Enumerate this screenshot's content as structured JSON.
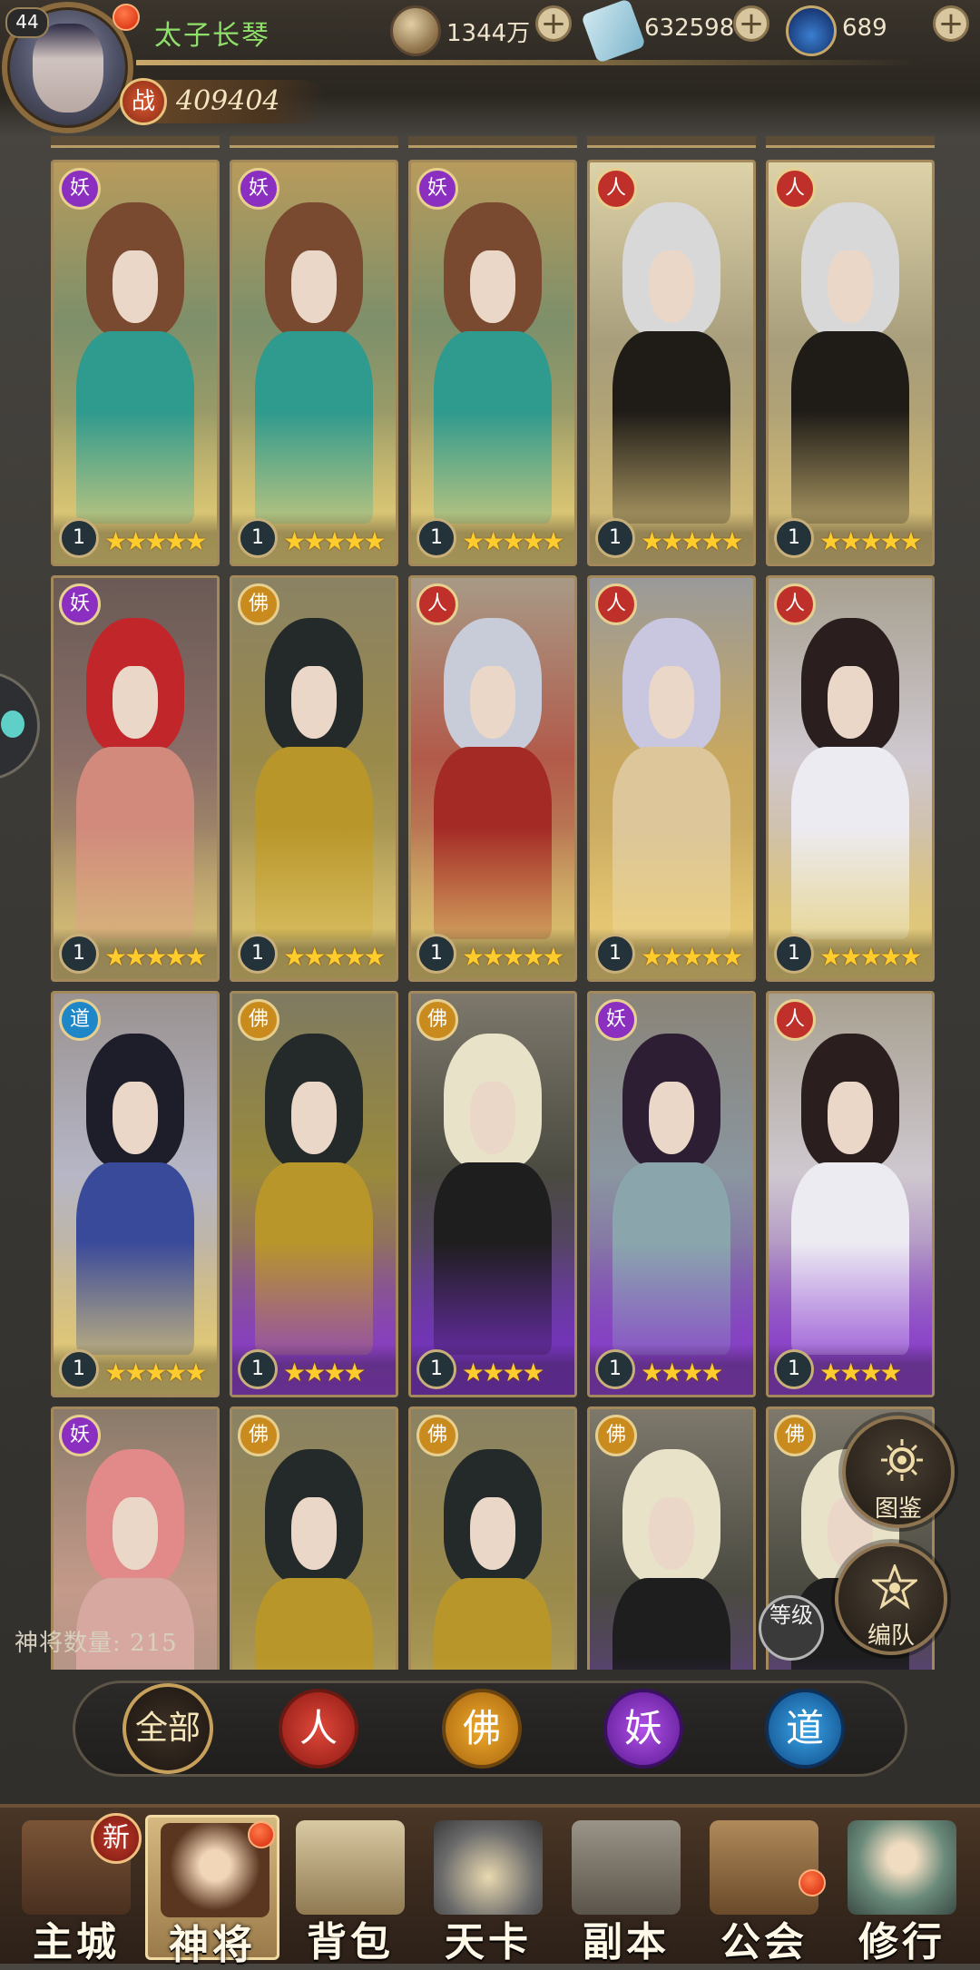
{
  "player": {
    "level": "44",
    "name": "太子长琴",
    "power_label": "战",
    "power": "409404"
  },
  "resources": [
    {
      "icon": "copper-coin-icon",
      "value": "1344万"
    },
    {
      "icon": "scroll-ticket-icon",
      "value": "632598"
    },
    {
      "icon": "spirit-flask-icon",
      "value": "689"
    }
  ],
  "colors": {
    "gold_star": "#ffcc2e",
    "faction_ren": "#c0302a",
    "faction_fo": "#c98a1e",
    "faction_yao": "#8a2fc0",
    "faction_dao": "#1f86c8"
  },
  "heroes": [
    {
      "faction": "妖",
      "level": "1",
      "stars": "★★★★★",
      "tone": "teal"
    },
    {
      "faction": "妖",
      "level": "1",
      "stars": "★★★★★",
      "tone": "teal"
    },
    {
      "faction": "妖",
      "level": "1",
      "stars": "★★★★★",
      "tone": "teal"
    },
    {
      "faction": "人",
      "level": "1",
      "stars": "★★★★★",
      "tone": "elder"
    },
    {
      "faction": "人",
      "level": "1",
      "stars": "★★★★★",
      "tone": "elder"
    },
    {
      "faction": "妖",
      "level": "1",
      "stars": "★★★★★",
      "tone": "fox"
    },
    {
      "faction": "佛",
      "level": "1",
      "stars": "★★★★★",
      "tone": "monk"
    },
    {
      "faction": "人",
      "level": "1",
      "stars": "★★★★★",
      "tone": "warrior"
    },
    {
      "faction": "人",
      "level": "1",
      "stars": "★★★★★",
      "tone": "feather"
    },
    {
      "faction": "人",
      "level": "1",
      "stars": "★★★★★",
      "tone": "bunny"
    },
    {
      "faction": "道",
      "level": "1",
      "stars": "★★★★★",
      "tone": "blue"
    },
    {
      "faction": "佛",
      "level": "1",
      "stars": "★★★★",
      "tone": "monk-purple"
    },
    {
      "faction": "佛",
      "level": "1",
      "stars": "★★★★",
      "tone": "white-hair"
    },
    {
      "faction": "妖",
      "level": "1",
      "stars": "★★★★",
      "tone": "fan"
    },
    {
      "faction": "人",
      "level": "1",
      "stars": "★★★★",
      "tone": "bunny-purple"
    },
    {
      "faction": "妖",
      "level": "",
      "stars": "",
      "tone": "pink"
    },
    {
      "faction": "佛",
      "level": "",
      "stars": "",
      "tone": "monk"
    },
    {
      "faction": "佛",
      "level": "",
      "stars": "",
      "tone": "monk"
    },
    {
      "faction": "佛",
      "level": "",
      "stars": "",
      "tone": "white-hair"
    },
    {
      "faction": "佛",
      "level": "",
      "stars": "",
      "tone": "white-hair"
    }
  ],
  "hero_count_label": "神将数量:  215",
  "side_buttons": {
    "codex": "图鉴",
    "formation": "编队",
    "sort": "等级"
  },
  "filters": [
    {
      "label": "全部",
      "key": "all"
    },
    {
      "label": "人",
      "key": "ren"
    },
    {
      "label": "佛",
      "key": "fo"
    },
    {
      "label": "妖",
      "key": "yao"
    },
    {
      "label": "道",
      "key": "dao"
    }
  ],
  "nav": [
    {
      "label": "主城",
      "icon": "city-icon"
    },
    {
      "label": "神将",
      "icon": "hero-icon"
    },
    {
      "label": "背包",
      "icon": "bag-icon"
    },
    {
      "label": "天卡",
      "icon": "card-icon"
    },
    {
      "label": "副本",
      "icon": "dungeon-icon"
    },
    {
      "label": "公会",
      "icon": "guild-icon"
    },
    {
      "label": "修行",
      "icon": "training-icon"
    }
  ],
  "nav_new_badge": "新"
}
